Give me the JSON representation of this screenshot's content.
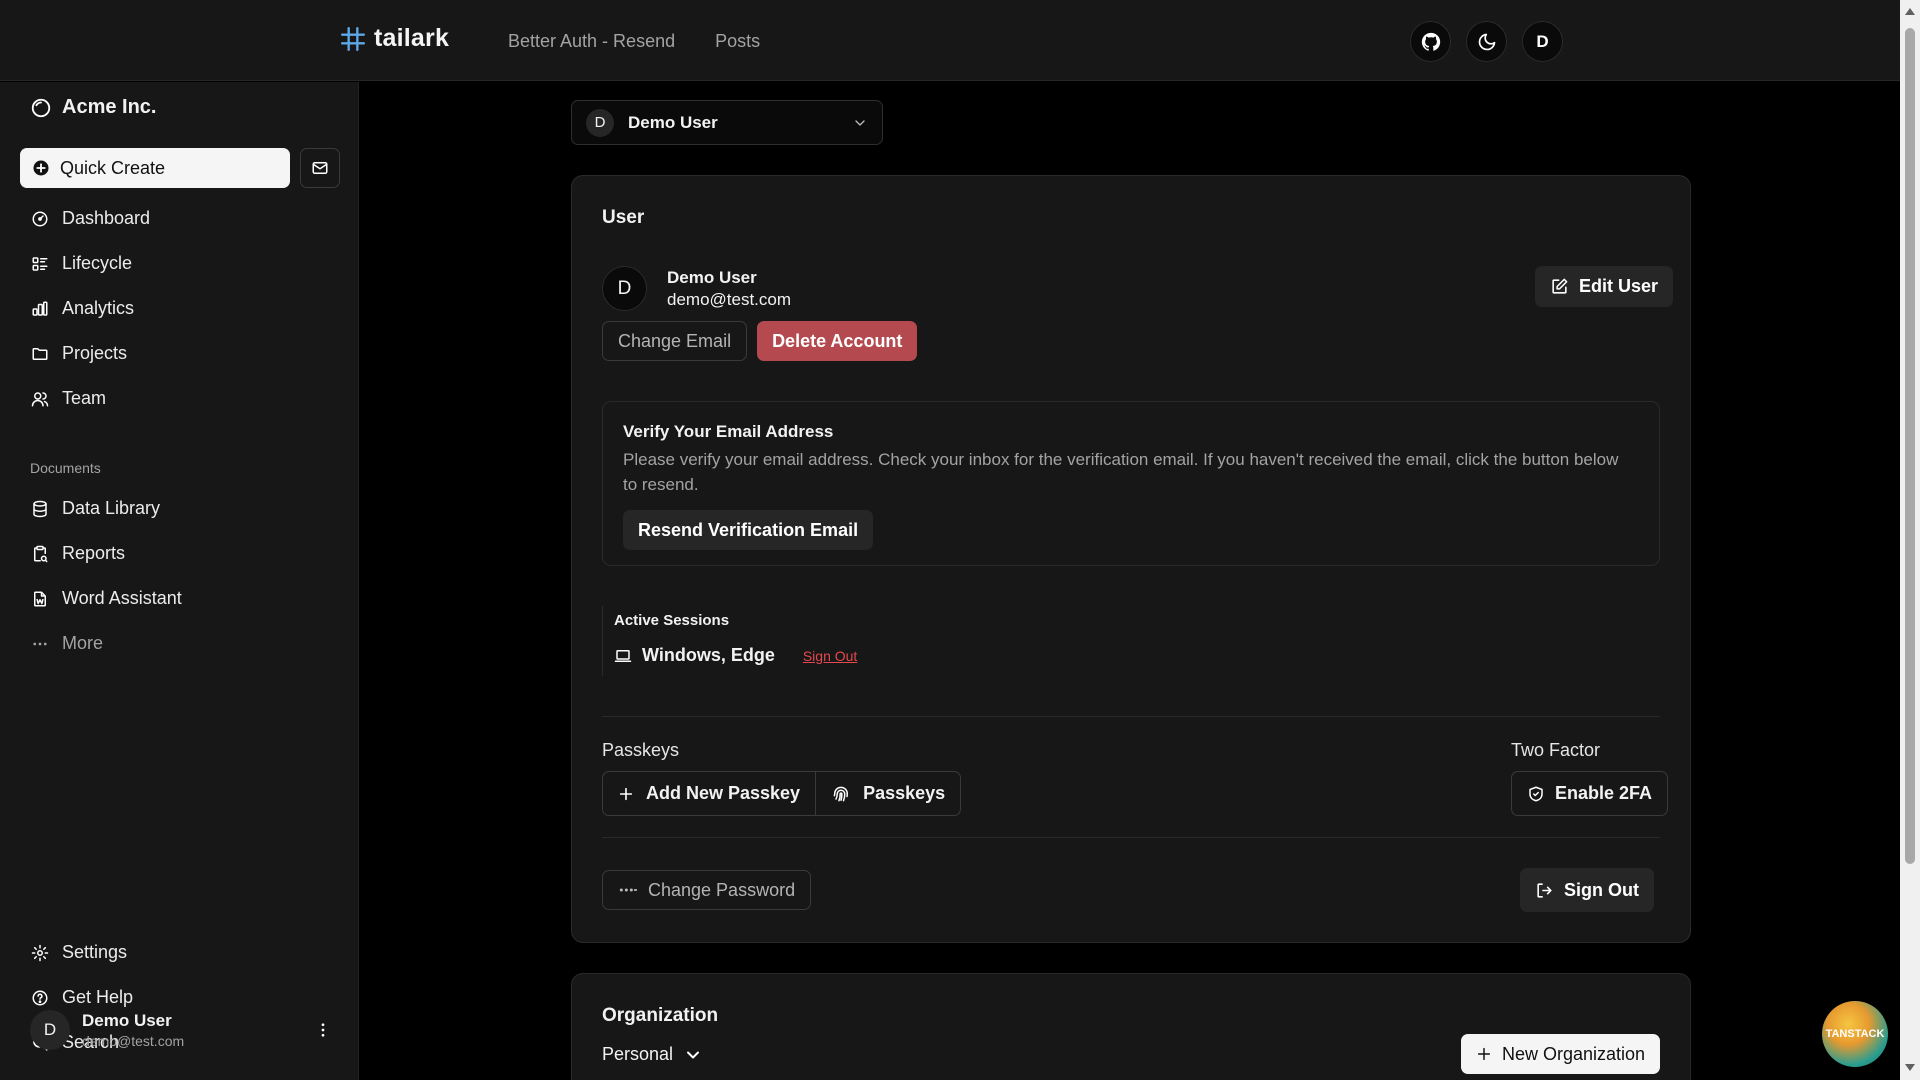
{
  "header": {
    "brand": "tailark",
    "nav": [
      "Better Auth - Resend",
      "Posts"
    ],
    "avatar_initial": "D"
  },
  "sidebar": {
    "org_name": "Acme Inc.",
    "quick_create": "Quick Create",
    "main_items": [
      {
        "label": "Dashboard",
        "icon": "dashboard-icon"
      },
      {
        "label": "Lifecycle",
        "icon": "list-details-icon"
      },
      {
        "label": "Analytics",
        "icon": "chart-bar-icon"
      },
      {
        "label": "Projects",
        "icon": "folder-icon"
      },
      {
        "label": "Team",
        "icon": "users-icon"
      }
    ],
    "documents_label": "Documents",
    "doc_items": [
      {
        "label": "Data Library",
        "icon": "database-icon"
      },
      {
        "label": "Reports",
        "icon": "report-icon"
      },
      {
        "label": "Word Assistant",
        "icon": "file-word-icon"
      },
      {
        "label": "More",
        "icon": "dots-icon"
      }
    ],
    "bottom_items": [
      {
        "label": "Settings",
        "icon": "settings-icon"
      },
      {
        "label": "Get Help",
        "icon": "help-icon"
      },
      {
        "label": "Search",
        "icon": "search-icon"
      }
    ],
    "user": {
      "initial": "D",
      "name": "Demo User",
      "email": "demo@test.com"
    }
  },
  "main": {
    "user_select": {
      "initial": "D",
      "name": "Demo User"
    },
    "user_card": {
      "title": "User",
      "initial": "D",
      "name": "Demo User",
      "email": "demo@test.com",
      "edit_user": "Edit User",
      "change_email": "Change Email",
      "delete_account": "Delete Account",
      "verify": {
        "title": "Verify Your Email Address",
        "text": "Please verify your email address. Check your inbox for the verification email. If you haven't received the email, click the button below to resend.",
        "button": "Resend Verification Email"
      },
      "sessions": {
        "title": "Active Sessions",
        "device": "Windows, Edge",
        "sign_out": "Sign Out"
      },
      "passkeys_label": "Passkeys",
      "add_passkey": "Add New Passkey",
      "passkeys_button": "Passkeys",
      "two_factor_label": "Two Factor",
      "enable_2fa": "Enable 2FA",
      "change_password": "Change Password",
      "sign_out": "Sign Out"
    },
    "org_card": {
      "title": "Organization",
      "current": "Personal",
      "new_org": "New Organization"
    }
  },
  "badge": {
    "text": "TANSTACK"
  }
}
